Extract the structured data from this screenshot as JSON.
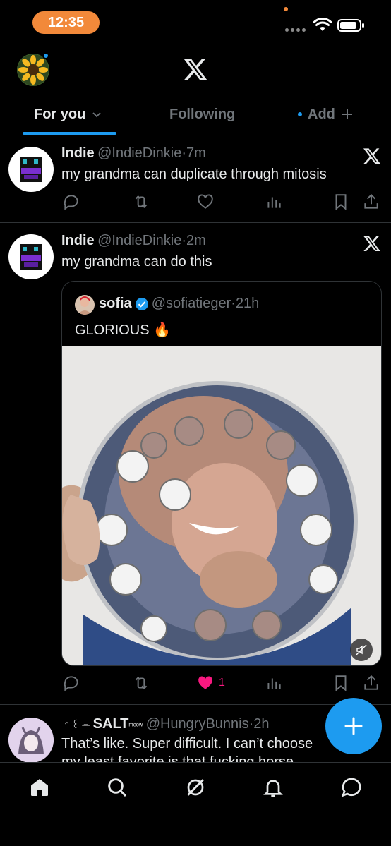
{
  "status_bar": {
    "time": "12:35",
    "icons": [
      "signal-dots-icon",
      "wifi-icon",
      "battery-icon"
    ]
  },
  "header": {
    "logo": "x-logo-icon",
    "tabs": [
      {
        "label": "For you",
        "active": true
      },
      {
        "label": "Following",
        "active": false
      },
      {
        "label": "Add",
        "active": false
      }
    ]
  },
  "feed": {
    "tweets": [
      {
        "name": "Indie",
        "handle": "@IndieDinkie",
        "time": "7m",
        "text": "my grandma can duplicate through mitosis",
        "actions": {
          "reply": "",
          "retweet": "",
          "like": "",
          "views": ""
        }
      },
      {
        "name": "Indie",
        "handle": "@IndieDinkie",
        "time": "2m",
        "text": "my grandma can do this",
        "quote": {
          "name": "sofia",
          "verified": true,
          "handle": "@sofiatieger",
          "time": "21h",
          "text": "GLORIOUS 🔥",
          "media": "video-gear-puzzle-grandma",
          "muted": true
        },
        "actions": {
          "reply": "",
          "retweet": "",
          "like": "1",
          "liked": true,
          "views": ""
        }
      },
      {
        "name": "SALT",
        "name_prefix": "ᵔ ꒰ ⌯",
        "name_suffix": "ᵐᵉᵒʷ",
        "handle": "@HungryBunnis",
        "time": "2h",
        "text": "That’s like. Super difficult. I can’t choose",
        "text_cut": "my least favorite is that fucking horse"
      }
    ]
  },
  "fab": {
    "icon": "plus-icon"
  },
  "bottom_nav": [
    "home-icon",
    "search-icon",
    "grok-icon",
    "notifications-icon",
    "messages-icon"
  ],
  "colors": {
    "accent": "#1d9bf0",
    "like": "#f91880",
    "time_pill": "#f2893a"
  }
}
